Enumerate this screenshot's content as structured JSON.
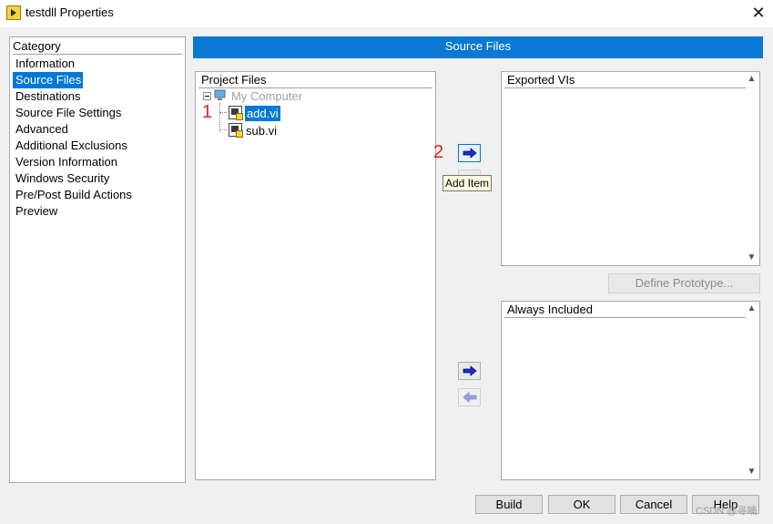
{
  "window": {
    "title": "testdll Properties",
    "close_glyph": "✕",
    "app_icon": "labview-project-icon"
  },
  "category": {
    "header": "Category",
    "items": [
      "Information",
      "Source Files",
      "Destinations",
      "Source File Settings",
      "Advanced",
      "Additional Exclusions",
      "Version Information",
      "Windows Security",
      "Pre/Post Build Actions",
      "Preview"
    ],
    "selected": "Source Files"
  },
  "section": {
    "title": "Source Files"
  },
  "project_files": {
    "header": "Project Files",
    "root": "My Computer",
    "files": [
      "add.vi",
      "sub.vi"
    ],
    "selected": "add.vi"
  },
  "annotations": {
    "one": "1",
    "two": "2"
  },
  "tooltip": {
    "text": "Add Item"
  },
  "exported": {
    "header": "Exported VIs"
  },
  "define_prototype": {
    "label": "Define Prototype..."
  },
  "always_included": {
    "header": "Always Included"
  },
  "buttons": {
    "build": "Build",
    "ok": "OK",
    "cancel": "Cancel",
    "help": "Help"
  },
  "watermark": "CSDN @寻喃",
  "colors": {
    "accent": "#0078d7",
    "section_bar": "#0a78d4",
    "annotation": "#e02020"
  }
}
